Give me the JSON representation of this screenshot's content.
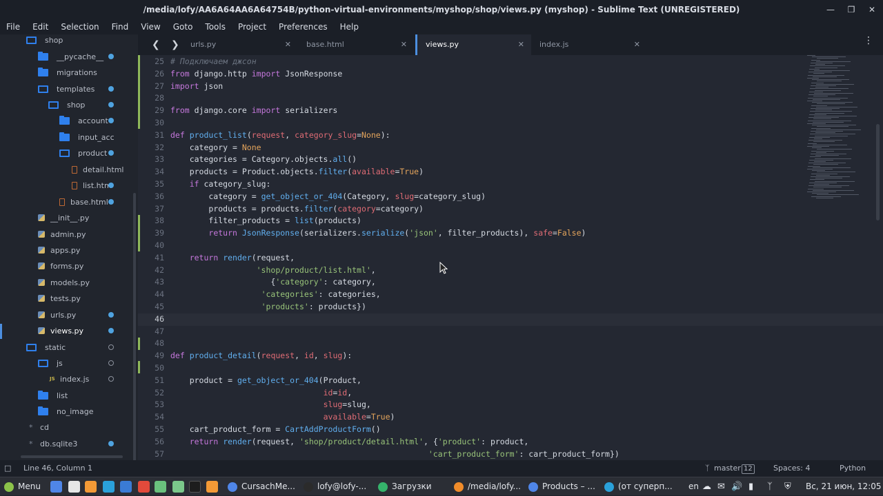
{
  "window": {
    "title": "/media/lofy/AA6A64AA6A64754B/python-virtual-environments/myshop/shop/views.py (myshop) - Sublime Text (UNREGISTERED)"
  },
  "menu": [
    "File",
    "Edit",
    "Selection",
    "Find",
    "View",
    "Goto",
    "Tools",
    "Project",
    "Preferences",
    "Help"
  ],
  "sidebar": {
    "items": [
      {
        "label": "shop",
        "type": "folder-open",
        "dot": "none"
      },
      {
        "label": "__pycache__",
        "type": "folder",
        "dot": "filled"
      },
      {
        "label": "migrations",
        "type": "folder",
        "dot": "none"
      },
      {
        "label": "templates",
        "type": "folder-open",
        "dot": "filled"
      },
      {
        "label": "shop",
        "type": "folder-open",
        "dot": "filled"
      },
      {
        "label": "account",
        "type": "folder",
        "dot": "filled"
      },
      {
        "label": "input_acc",
        "type": "folder",
        "dot": "none"
      },
      {
        "label": "product",
        "type": "folder-open",
        "dot": "filled"
      },
      {
        "label": "detail.html",
        "type": "html",
        "dot": "none"
      },
      {
        "label": "list.htm",
        "type": "html",
        "dot": "filled"
      },
      {
        "label": "base.html",
        "type": "html",
        "dot": "filled"
      },
      {
        "label": "__init__.py",
        "type": "py",
        "dot": "none"
      },
      {
        "label": "admin.py",
        "type": "py",
        "dot": "none"
      },
      {
        "label": "apps.py",
        "type": "py",
        "dot": "none"
      },
      {
        "label": "forms.py",
        "type": "py",
        "dot": "none"
      },
      {
        "label": "models.py",
        "type": "py",
        "dot": "none"
      },
      {
        "label": "tests.py",
        "type": "py",
        "dot": "none"
      },
      {
        "label": "urls.py",
        "type": "py",
        "dot": "filled"
      },
      {
        "label": "views.py",
        "type": "py",
        "dot": "filled"
      },
      {
        "label": "static",
        "type": "folder-open",
        "dot": "hollow"
      },
      {
        "label": "js",
        "type": "folder-open",
        "dot": "hollow"
      },
      {
        "label": "index.js",
        "type": "js",
        "dot": "hollow"
      },
      {
        "label": "list",
        "type": "folder",
        "dot": "none"
      },
      {
        "label": "no_image",
        "type": "folder",
        "dot": "none"
      },
      {
        "label": "cd",
        "type": "plain",
        "dot": "none"
      },
      {
        "label": "db.sqlite3",
        "type": "plain",
        "dot": "filled"
      }
    ]
  },
  "tabs": [
    {
      "label": "urls.py",
      "active": false
    },
    {
      "label": "base.html",
      "active": false
    },
    {
      "label": "views.py",
      "active": true
    },
    {
      "label": "index.js",
      "active": false
    }
  ],
  "editor": {
    "lines": [
      {
        "n": "25",
        "html": "<span class='cm'># Подключаем джсон</span>"
      },
      {
        "n": "26",
        "html": "<span class='kw'>from</span> django.http <span class='kw'>import</span> JsonResponse"
      },
      {
        "n": "27",
        "html": "<span class='kw'>import</span> json"
      },
      {
        "n": "28",
        "html": ""
      },
      {
        "n": "29",
        "html": "<span class='kw'>from</span> django.core <span class='kw'>import</span> serializers"
      },
      {
        "n": "30",
        "html": ""
      },
      {
        "n": "31",
        "html": "<span class='kw'>def</span> <span class='fn'>product_list</span>(<span class='pa'>request</span>, <span class='pa'>category_slug</span>=<span class='nu'>None</span>):"
      },
      {
        "n": "32",
        "html": "    category = <span class='nu'>None</span>"
      },
      {
        "n": "33",
        "html": "    categories = Category.objects.<span class='fn'>all</span>()"
      },
      {
        "n": "34",
        "html": "    products = Product.objects.<span class='fn'>filter</span>(<span class='pa'>available</span>=<span class='nu'>True</span>)"
      },
      {
        "n": "35",
        "html": "    <span class='kw'>if</span> category_slug:"
      },
      {
        "n": "36",
        "html": "        category = <span class='fn'>get_object_or_404</span>(Category, <span class='pa'>slug</span>=category_slug)"
      },
      {
        "n": "37",
        "html": "        products = products.<span class='fn'>filter</span>(<span class='pa'>category</span>=category)"
      },
      {
        "n": "38",
        "html": "        filter_products = <span class='fn'>list</span>(products)"
      },
      {
        "n": "39",
        "html": "        <span class='kw'>return</span> <span class='fn'>JsonResponse</span>(serializers.<span class='fn'>serialize</span>(<span class='st'>'json'</span>, filter_products), <span class='pa'>safe</span>=<span class='nu'>False</span>)"
      },
      {
        "n": "40",
        "html": ""
      },
      {
        "n": "41",
        "html": "    <span class='kw'>return</span> <span class='fn'>render</span>(request,"
      },
      {
        "n": "42",
        "html": "                  <span class='st'>'shop/product/list.html'</span>,"
      },
      {
        "n": "43",
        "html": "                     {<span class='st'>'category'</span>: category,"
      },
      {
        "n": "44",
        "html": "                   <span class='st'>'categories'</span>: categories,"
      },
      {
        "n": "45",
        "html": "                   <span class='st'>'products'</span>: products})"
      },
      {
        "n": "46",
        "html": ""
      },
      {
        "n": "47",
        "html": ""
      },
      {
        "n": "48",
        "html": ""
      },
      {
        "n": "49",
        "html": "<span class='kw'>def</span> <span class='fn'>product_detail</span>(<span class='pa'>request</span>, <span class='pa'>id</span>, <span class='pa'>slug</span>):"
      },
      {
        "n": "50",
        "html": ""
      },
      {
        "n": "51",
        "html": "    product = <span class='fn'>get_object_or_404</span>(Product,"
      },
      {
        "n": "52",
        "html": "                                <span class='pa'>id</span>=<span class='pa'>id</span>,"
      },
      {
        "n": "53",
        "html": "                                <span class='pa'>slug</span>=slug,"
      },
      {
        "n": "54",
        "html": "                                <span class='pa'>available</span>=<span class='nu'>True</span>)"
      },
      {
        "n": "55",
        "html": "    cart_product_form = <span class='fn'>CartAddProductForm</span>()"
      },
      {
        "n": "56",
        "html": "    <span class='kw'>return</span> <span class='fn'>render</span>(request, <span class='st'>'shop/product/detail.html'</span>, {<span class='st'>'product'</span>: product,"
      },
      {
        "n": "57",
        "html": "                                                      <span class='st'>'cart_product_form'</span>: cart_product_form})"
      }
    ],
    "current_line": "46"
  },
  "status": {
    "position": "Line 46, Column 1",
    "branch": "master",
    "branch_count": "12",
    "indent": "Spaces: 4",
    "syntax": "Python"
  },
  "taskbar": {
    "menu_label": "Menu",
    "windows": [
      {
        "label": "CursachMe...",
        "icon_color": "#4f86e8"
      },
      {
        "label": "lofy@lofy-...",
        "icon_color": "#2b2b2b"
      },
      {
        "label": "Загрузки",
        "icon_color": "#35b36b"
      },
      {
        "label": "/media/lofy...",
        "icon_color": "#f08c2a"
      },
      {
        "label": "Products – ...",
        "icon_color": "#4f86e8"
      },
      {
        "label": "(от суперп...",
        "icon_color": "#2aa1da"
      }
    ],
    "lang": "en",
    "clock": "Вс, 21 июн, 12:05"
  }
}
